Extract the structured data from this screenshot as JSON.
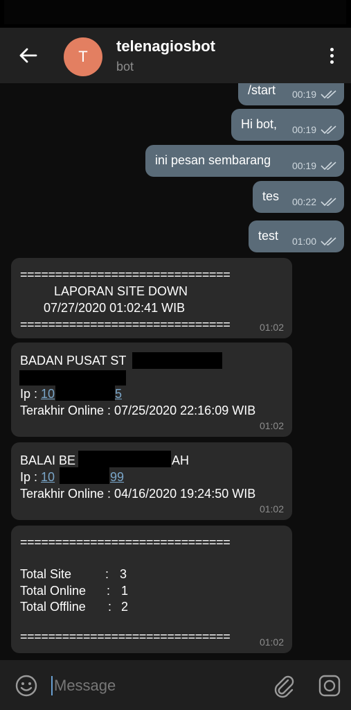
{
  "header": {
    "avatar_letter": "T",
    "bot_name": "telenagiosbot",
    "bot_subtitle": "bot"
  },
  "outgoing": [
    {
      "text": "/start",
      "time": "00:19"
    },
    {
      "text": "Hi bot,",
      "time": "00:19"
    },
    {
      "text": "ini pesan sembarang",
      "time": "00:19"
    },
    {
      "text": "tes",
      "time": "00:22"
    },
    {
      "text": "test",
      "time": "01:00"
    }
  ],
  "report": {
    "separator": "==============================",
    "title": "LAPORAN SITE DOWN",
    "datetime": "07/27/2020 01:02:41 WIB",
    "time": "01:02"
  },
  "site1": {
    "name_prefix": "BADAN PUSAT ST",
    "ip_label": "Ip : ",
    "ip_start": "10",
    "ip_end": "5",
    "last_online": "Terakhir Online : 07/25/2020 22:16:09 WIB",
    "time": "01:02"
  },
  "site2": {
    "name_prefix": "BALAI BE",
    "name_suffix": "AH",
    "ip_label": "Ip : ",
    "ip_start": "10",
    "ip_end": "99",
    "last_online": "Terakhir Online : 04/16/2020 19:24:50 WIB",
    "time": "01:02"
  },
  "summary": {
    "separator": "==============================",
    "total_site_label": "Total Site",
    "total_site_value": "3",
    "total_online_label": "Total Online",
    "total_online_value": "1",
    "total_offline_label": "Total Offline",
    "total_offline_value": "2",
    "colon": ":",
    "time": "01:02"
  },
  "composer": {
    "placeholder": "Message"
  },
  "icons": {
    "back": "arrow-left-icon",
    "menu": "more-vertical-icon",
    "emoji": "smiley-icon",
    "attach": "paperclip-icon",
    "camera": "camera-icon",
    "read": "double-check-icon"
  },
  "colors": {
    "avatar": "#e37f61",
    "outgoing_bubble": "#5a6b78",
    "incoming_bubble": "#2a2a2a",
    "link": "#7aa6c9"
  }
}
